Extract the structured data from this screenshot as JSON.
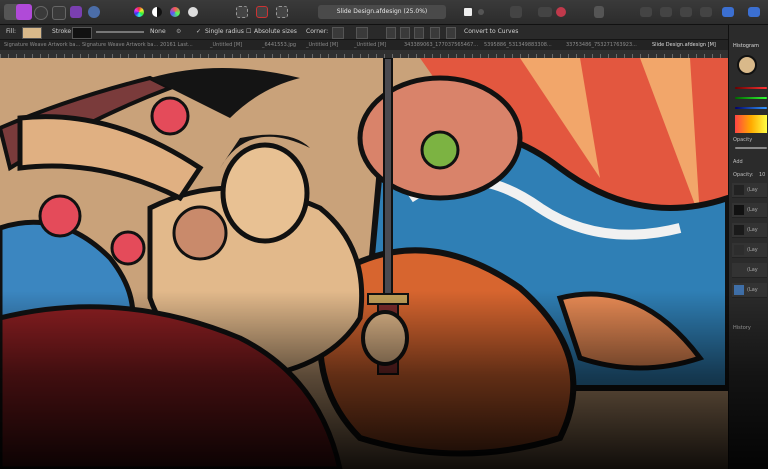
{
  "app": {
    "accent": "#8a5cf6"
  },
  "toolbar": {
    "document_title": "Slide Design.afdesign (25.0%)",
    "convert_to_curves": "Convert to Curves"
  },
  "context_bar": {
    "fill_label": "Fill:",
    "stroke_label": "Stroke",
    "stroke_none": "None",
    "single_radius": "Single radius",
    "absolute_sizes": "Absolute sizes",
    "corner_label": "Corner:",
    "fill_color": "#d9b98a",
    "stroke_color": "#111111"
  },
  "tabs": [
    "Signature Weave Artwork ba...",
    "Signature Weave Artwork ba...",
    "20161 Last...",
    "_Untitled [M]",
    "_6441553.jpg",
    "_Untitled [M]",
    "_Untitled [M]",
    "343389063_177037565467...",
    "5395886_531349883308...",
    "33753486_753271763923...",
    "Slide Design.afdesign [M]"
  ],
  "panel": {
    "histogram": "Histogram",
    "opacity_label": "Opacity",
    "add_label": "Add",
    "layer_opacity_label": "Opacity:",
    "layer_opacity_value": "10",
    "history": "History",
    "layers": [
      "(Lay",
      "(Lay",
      "(Lay",
      "(Lay",
      "(Lay",
      "(Lay"
    ]
  }
}
